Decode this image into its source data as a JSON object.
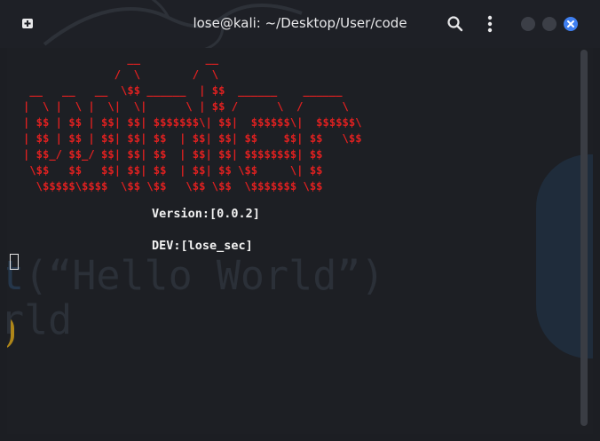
{
  "window": {
    "title": "lose@kali: ~/Desktop/User/code"
  },
  "icons": {
    "new_tab": "new-tab-icon",
    "search": "search-icon",
    "menu": "kebab-menu-icon",
    "minimize": "minimize-icon",
    "maximize": "maximize-icon",
    "close": "close-icon"
  },
  "colors": {
    "banner": "#e02020",
    "text": "#f2f2f2",
    "close_button": "#3f7ff0",
    "background": "#1d1f24"
  },
  "terminal": {
    "banner_lines": [
      "                __          __",
      "              /  \\        /  \\",
      " __   __   __  \\$$ ______  | $$  ______    ______",
      "|  \\ |  \\ |  \\|  \\|      \\ | $$ /      \\  /      \\",
      "| $$ | $$ | $$| $$| $$$$$$$\\| $$|  $$$$$$\\|  $$$$$$\\",
      "| $$ | $$ | $$| $$| $$  | $$| $$| $$    $$| $$   \\$$",
      "| $$_/ $$_/ $$| $$| $$  | $$| $$| $$$$$$$$| $$",
      " \\$$   $$   $$| $$| $$  | $$| $$ \\$$     \\| $$",
      "  \\$$$$$\\$$$$  \\$$ \\$$   \\$$ \\$$  \\$$$$$$$ \\$$"
    ],
    "version_line": "Version:[0.0.2]",
    "dev_line": "DEV:[lose_sec]"
  },
  "wallpaper_text": {
    "line1_prefix": "t",
    "line1": "(“Hello World”)",
    "line2": "rld"
  }
}
